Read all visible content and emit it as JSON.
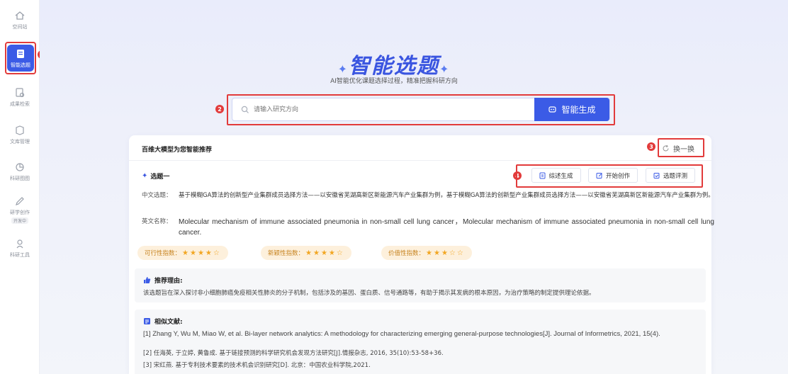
{
  "sidebar": {
    "items": [
      {
        "label": "空间站",
        "icon": "home-icon"
      },
      {
        "label": "智能选题",
        "icon": "clipboard-icon"
      },
      {
        "label": "成果检索",
        "icon": "search-doc-icon"
      },
      {
        "label": "文库管理",
        "icon": "library-icon"
      },
      {
        "label": "科研图图",
        "icon": "chart-icon"
      },
      {
        "label": "研学创作",
        "icon": "edit-icon",
        "tag": "开发中"
      },
      {
        "label": "科研工具",
        "icon": "tools-icon"
      }
    ]
  },
  "badges": {
    "b1": "1",
    "b2": "2",
    "b3": "3",
    "b4": "4"
  },
  "hero": {
    "title": "智能选题",
    "subtitle": "AI智能优化课题选择过程，精准把握科研方向"
  },
  "search": {
    "placeholder": "请输入研究方向",
    "button_label": "智能生成"
  },
  "card": {
    "title": "百维大模型为您智能推荐",
    "refresh_label": "换一换",
    "topic_title": "选题一",
    "actions": {
      "review": "综述生成",
      "create": "开始创作",
      "evaluate": "选题评测"
    },
    "zh_label": "中文选题：",
    "zh_value": "基于模糊GA算法的创新型产业集群成员选择方法——以安徽省芜湖高新区新能源汽车产业集群为例，基于模糊GA算法的创新型产业集群成员选择方法——以安徽省芜湖高新区新能源汽车产业集群为例。",
    "en_label": "英文名称：",
    "en_value": "Molecular mechanism of immune associated pneumonia in non-small cell lung cancer，Molecular mechanism of immune associated pneumonia in non-small cell lung cancer.",
    "indices": [
      {
        "label": "可行性指数：",
        "stars": "★★★★☆",
        "rating": 4
      },
      {
        "label": "新颖性指数：",
        "stars": "★★★★☆",
        "rating": 4
      },
      {
        "label": "价值性指数：",
        "stars": "★★★☆☆",
        "rating": 3
      }
    ],
    "reason": {
      "title": "推荐理由:",
      "text": "该选题旨在深入探讨非小细胞肺癌免疫相关性肺炎的分子机制，包括涉及的基因、蛋白质、信号通路等，有助于揭示其发病的根本原因，为治疗策略的制定提供理论依据。"
    },
    "literature": {
      "title": "相似文献:",
      "items": [
        "[1] Zhang Y, Wu M, Miao W, et al. Bi-layer network analytics: A methodology for characterizing emerging general-purpose technologies[J]. Journal of Informetrics, 2021, 15(4).",
        "[2] 任海英, 于立婷, 黄鲁成. 基于链接预测的科学研究机会发现方法研究[J].情报杂志, 2016, 35(10):53-58+36.",
        "[3] 宋红燕. 基于专利技术要素的技术机会识别研究[D]. 北京：中国农业科学院,2021."
      ]
    }
  },
  "colors": {
    "accent": "#3b5be6",
    "highlight_red": "#e23b3b",
    "star": "#f2a622",
    "pill_bg": "#fdf0dc"
  }
}
